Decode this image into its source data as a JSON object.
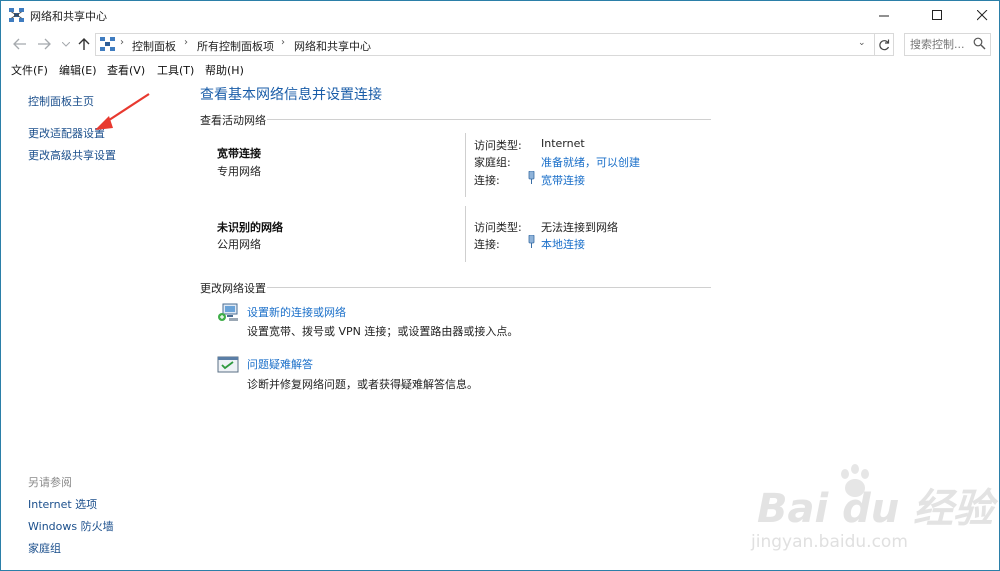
{
  "window": {
    "title": "网络和共享中心",
    "controls": {
      "minimize": "—",
      "maximize": "☐",
      "close": "✕"
    }
  },
  "nav": {
    "breadcrumb": [
      "控制面板",
      "所有控制面板项",
      "网络和共享中心"
    ],
    "search_placeholder": "搜索控制...",
    "icons": [
      "back-arrow-icon",
      "forward-arrow-icon",
      "up-arrow-icon",
      "refresh-icon",
      "search-icon"
    ]
  },
  "menu": [
    "文件(F)",
    "编辑(E)",
    "查看(V)",
    "工具(T)",
    "帮助(H)"
  ],
  "sidebar": {
    "links": [
      "控制面板主页",
      "更改适配器设置",
      "更改高级共享设置"
    ],
    "see_also_title": "另请参阅",
    "see_also": [
      "Internet 选项",
      "Windows 防火墙",
      "家庭组"
    ]
  },
  "main": {
    "title": "查看基本网络信息并设置连接",
    "active_header": "查看活动网络",
    "networks": [
      {
        "name": "宽带连接",
        "type": "专用网络",
        "access_label": "访问类型:",
        "access_value": "Internet",
        "homegroup_label": "家庭组:",
        "homegroup_value": "准备就绪，可以创建",
        "conn_label": "连接:",
        "conn_value": "宽带连接"
      },
      {
        "name": "未识别的网络",
        "type": "公用网络",
        "access_label": "访问类型:",
        "access_value": "无法连接到网络",
        "conn_label": "连接:",
        "conn_value": "本地连接"
      }
    ],
    "change_header": "更改网络设置",
    "tasks": [
      {
        "link": "设置新的连接或网络",
        "desc": "设置宽带、拨号或 VPN 连接；或设置路由器或接入点。"
      },
      {
        "link": "问题疑难解答",
        "desc": "诊断并修复网络问题，或者获得疑难解答信息。"
      }
    ]
  },
  "watermark": {
    "brand": "Bai du 经验",
    "site": "jingyan.baidu.com"
  },
  "colors": {
    "link": "#1a6fc9",
    "title": "#1a5da8",
    "annotation_arrow": "#e8392f",
    "border": "#2b7fa8"
  }
}
